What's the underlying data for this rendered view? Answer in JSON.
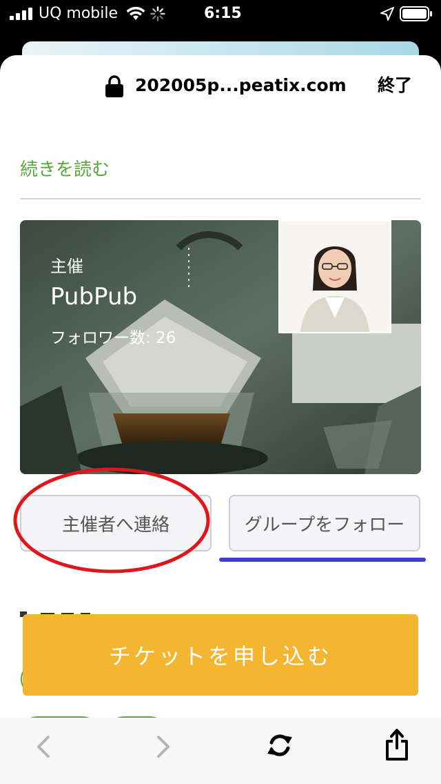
{
  "status_bar": {
    "carrier": "UQ mobile",
    "time": "6:15"
  },
  "browser": {
    "url": "202005p...peatix.com",
    "done_label": "終了"
  },
  "content": {
    "read_more": "続きを読む",
    "organizer": {
      "label": "主催",
      "name": "PubPub",
      "followers": "フォロワー数: 26"
    },
    "buttons": {
      "contact": "主催者へ連絡",
      "follow": "グループをフォロー"
    },
    "ticket_button": "チケットを申し込む"
  },
  "colors": {
    "accent_green": "#5aa63c",
    "ticket_orange": "#f4b630",
    "annotation_red": "#e0161c",
    "annotation_blue": "#3f3fbf"
  },
  "icons": {
    "lock": "lock-icon",
    "back": "chevron-left-icon",
    "forward": "chevron-right-icon",
    "reload": "reload-icon",
    "share": "share-icon"
  }
}
